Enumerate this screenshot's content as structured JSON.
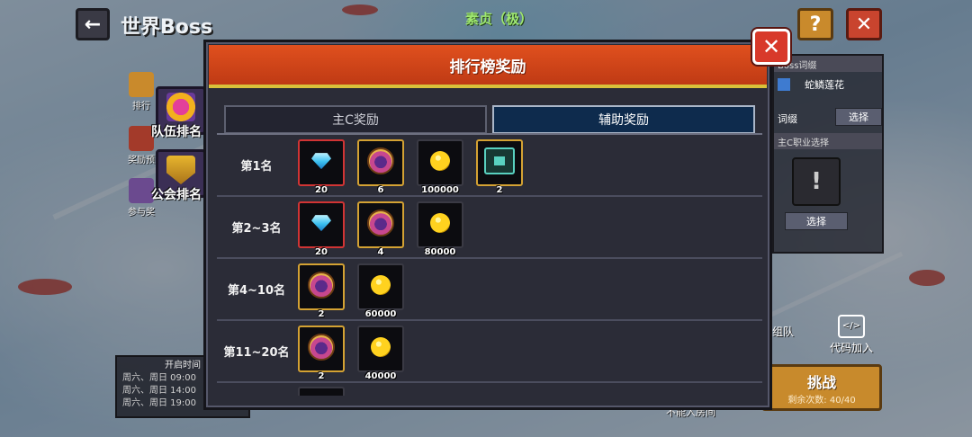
{
  "topbar": {
    "back_icon": "back-arrow-icon",
    "title": "世界Boss",
    "boss_name": "素贞（极）",
    "help_label": "?",
    "close_label": "✕"
  },
  "left": {
    "mini_1": "排行",
    "mini_2": "奖励预",
    "mini_3": "参与奖",
    "team_rank": "队伍排名",
    "guild_rank": "公会排名",
    "open_time": {
      "title": "开启时间",
      "lines": [
        "周六、周日 09:00",
        "周六、周日 14:00",
        "周六、周日 19:00"
      ]
    }
  },
  "right": {
    "boss_entry_head": "Boss词缀",
    "boss_entry": "蛇鳞莲花",
    "entry_label": "词缀",
    "select_1": "选择",
    "class_head": "主C职业选择",
    "slot_glyph": "!",
    "select_2": "选择",
    "team_up": "组队",
    "code_join": "代码加入",
    "code_icon": "</>",
    "challenge": "挑战",
    "remaining": "剩余次数: 40/40",
    "no_entry": "不能入房间"
  },
  "modal": {
    "title": "排行榜奖励",
    "close_label": "✕",
    "tabs": [
      {
        "label": "主C奖励",
        "active": false
      },
      {
        "label": "辅助奖励",
        "active": true
      }
    ],
    "rows": [
      {
        "rank": "第1名",
        "rewards": [
          {
            "icon": "diamond-icon",
            "frame": "red",
            "qty": "20"
          },
          {
            "icon": "chest-icon",
            "frame": "gold",
            "qty": "6"
          },
          {
            "icon": "gold-coin-icon",
            "frame": "plain",
            "qty": "100000"
          },
          {
            "icon": "armor-icon",
            "frame": "gold",
            "qty": "2"
          }
        ]
      },
      {
        "rank": "第2~3名",
        "rewards": [
          {
            "icon": "diamond-icon",
            "frame": "red",
            "qty": "20"
          },
          {
            "icon": "chest-icon",
            "frame": "gold",
            "qty": "4"
          },
          {
            "icon": "gold-coin-icon",
            "frame": "plain",
            "qty": "80000"
          }
        ]
      },
      {
        "rank": "第4~10名",
        "rewards": [
          {
            "icon": "chest-icon",
            "frame": "gold",
            "qty": "2"
          },
          {
            "icon": "gold-coin-icon",
            "frame": "plain",
            "qty": "60000"
          }
        ]
      },
      {
        "rank": "第11~20名",
        "rewards": [
          {
            "icon": "chest-icon",
            "frame": "gold",
            "qty": "2"
          },
          {
            "icon": "gold-coin-icon",
            "frame": "plain",
            "qty": "40000"
          }
        ]
      }
    ]
  },
  "colors": {
    "header": "#d9471a",
    "header_border": "#d9c13a",
    "active_tab": "#0e2b4d",
    "panel": "#2b2c37"
  }
}
